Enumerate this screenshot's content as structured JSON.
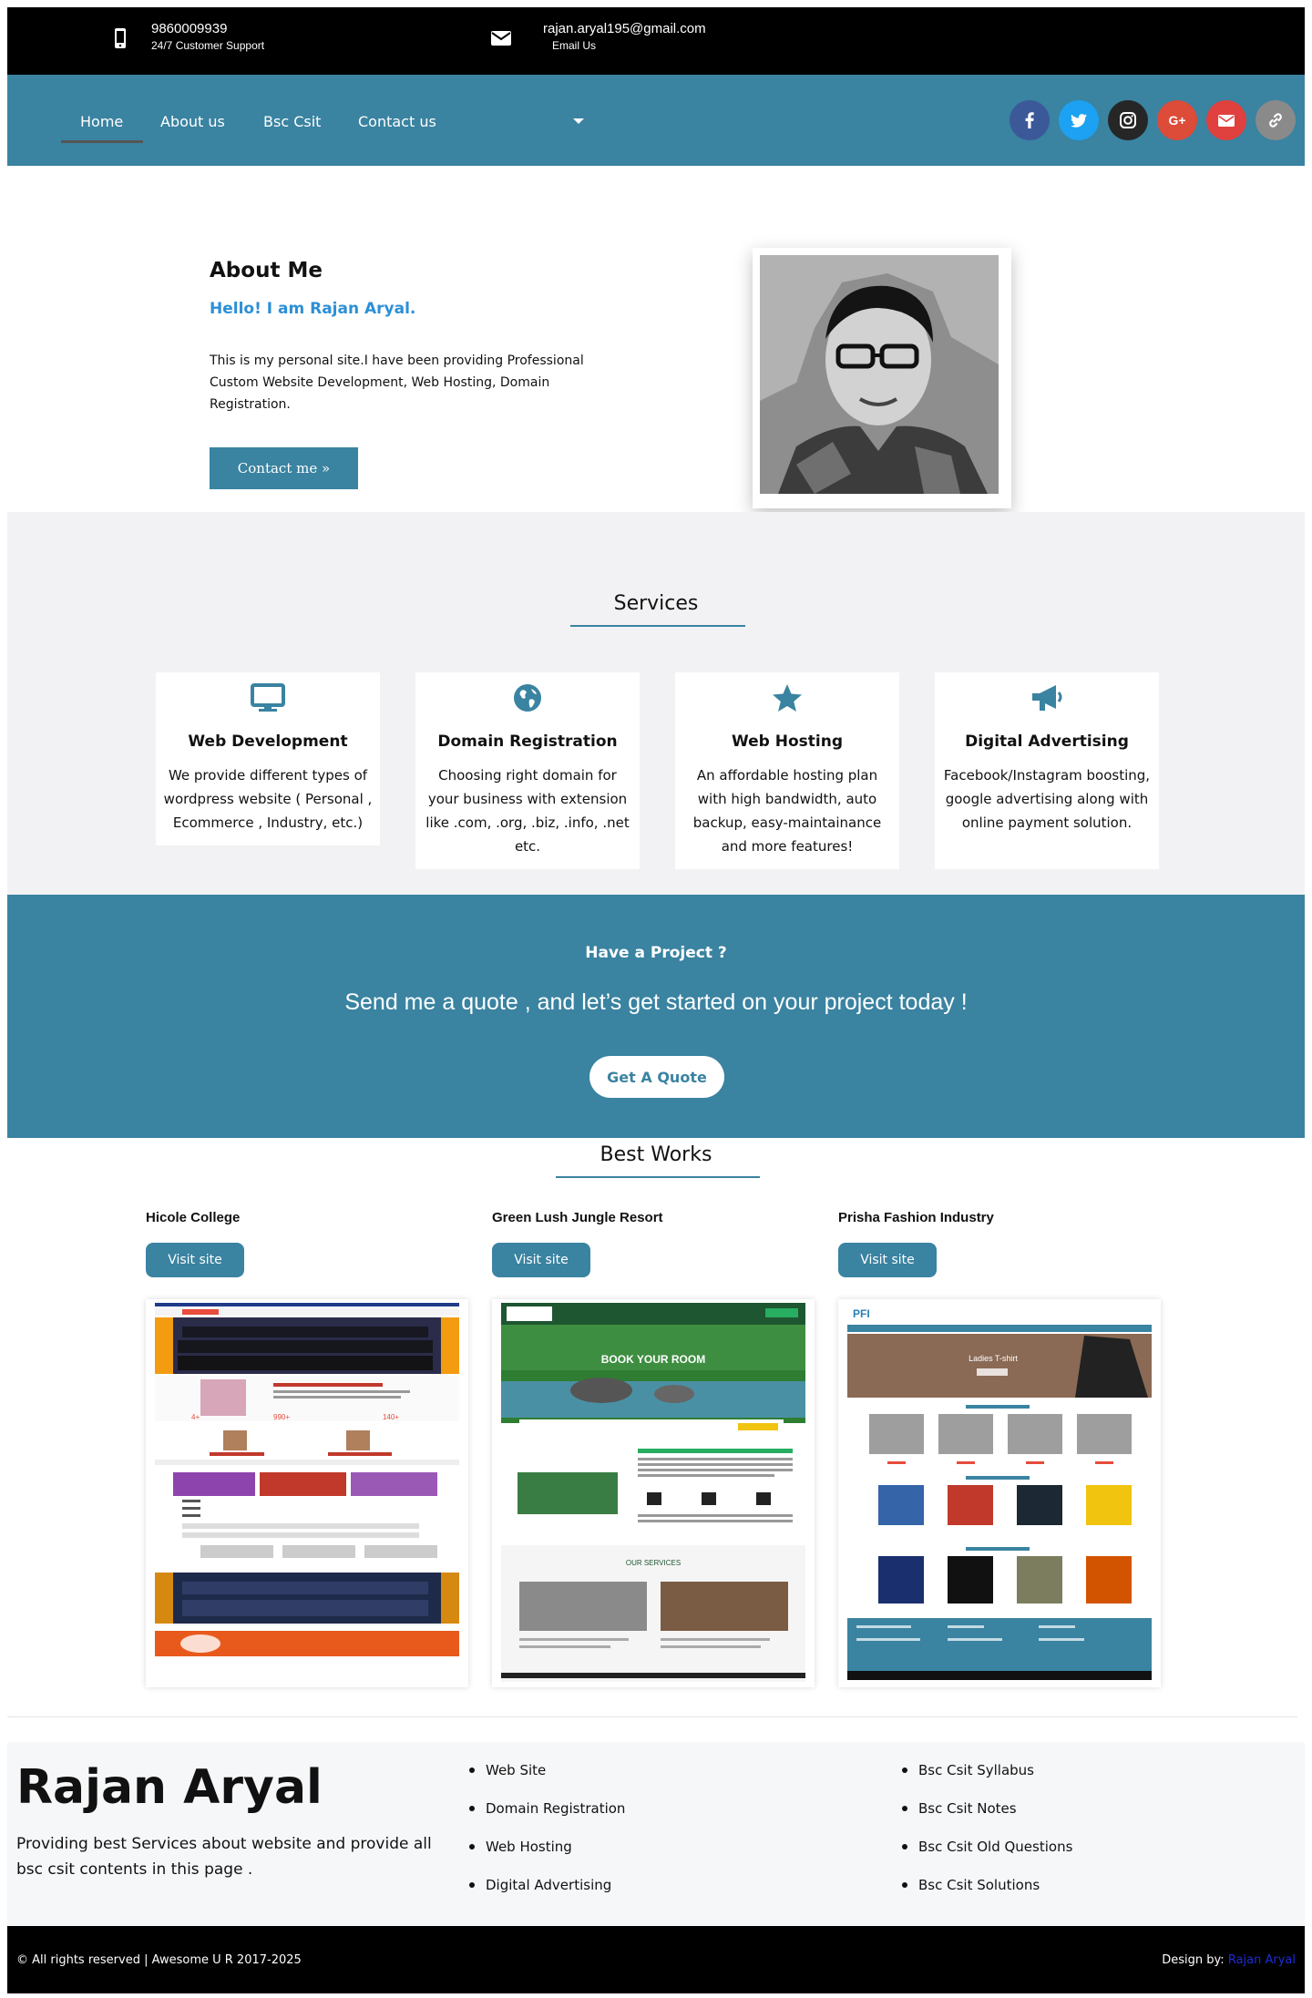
{
  "topbar": {
    "phone": "9860009939",
    "phone_sub": "24/7 Customer Support",
    "email": "rajan.aryal195@gmail.com",
    "email_sub": "Email Us"
  },
  "nav": {
    "items": [
      "Home",
      "About us",
      "Bsc Csit",
      "Contact us"
    ],
    "social": [
      {
        "name": "facebook-icon",
        "color": "#3b5998",
        "glyph": "f"
      },
      {
        "name": "twitter-icon",
        "color": "#1da1f2",
        "glyph": "t"
      },
      {
        "name": "instagram-icon",
        "color": "#262626",
        "glyph": "◎"
      },
      {
        "name": "google-plus-icon",
        "color": "#dd4b39",
        "glyph": "G+"
      },
      {
        "name": "mail-icon",
        "color": "#e0403e",
        "glyph": "✉"
      },
      {
        "name": "link-icon",
        "color": "#8a8a8a",
        "glyph": "∞"
      }
    ]
  },
  "about": {
    "title": "About Me",
    "hello": "Hello! I am Rajan Aryal.",
    "desc": "This is my personal site.I have been providing Professional Custom Website Development, Web Hosting, Domain Registration.",
    "button": "Contact me »"
  },
  "services": {
    "title": "Services",
    "items": [
      {
        "icon": "monitor-icon",
        "title": "Web Development",
        "desc": "We provide different types of wordpress website ( Personal , Ecommerce , Industry, etc.)"
      },
      {
        "icon": "globe-icon",
        "title": "Domain Registration",
        "desc": "Choosing right domain for your business with extension like .com, .org, .biz, .info, .net etc."
      },
      {
        "icon": "star-icon",
        "title": "Web Hosting",
        "desc": "An affordable hosting plan with high bandwidth, auto backup, easy-maintainance and more features!"
      },
      {
        "icon": "megaphone-icon",
        "title": "Digital Advertising",
        "desc": "Facebook/Instagram boosting, google advertising along with online payment solution."
      }
    ]
  },
  "project": {
    "heading": "Have a Project ?",
    "text": "Send me a quote , and let’s get started on your project today !",
    "button": "Get A Quote"
  },
  "works": {
    "title": "Best Works",
    "items": [
      {
        "name": "Hicole College",
        "button": "Visit site"
      },
      {
        "name": "Green Lush Jungle Resort",
        "button": "Visit site"
      },
      {
        "name": "Prisha Fashion Industry",
        "button": "Visit site"
      }
    ]
  },
  "footer": {
    "name": "Rajan Aryal",
    "desc": "Providing best Services about website and provide all bsc csit contents in this page .",
    "col1": [
      "Web Site",
      "Domain Registration",
      "Web Hosting",
      "Digital Advertising"
    ],
    "col2": [
      "Bsc Csit Syllabus",
      "Bsc Csit Notes",
      "Bsc Csit Old Questions",
      "Bsc Csit Solutions"
    ],
    "copyright": "© All rights reserved | Awesome U R 2017-2025",
    "design_label": "Design by:",
    "design_link": "Rajan Aryal"
  },
  "colors": {
    "accent": "#3a83a1",
    "hello": "#2d8fd6",
    "topbar": "#000000",
    "footer_link": "#1e2cd6"
  }
}
